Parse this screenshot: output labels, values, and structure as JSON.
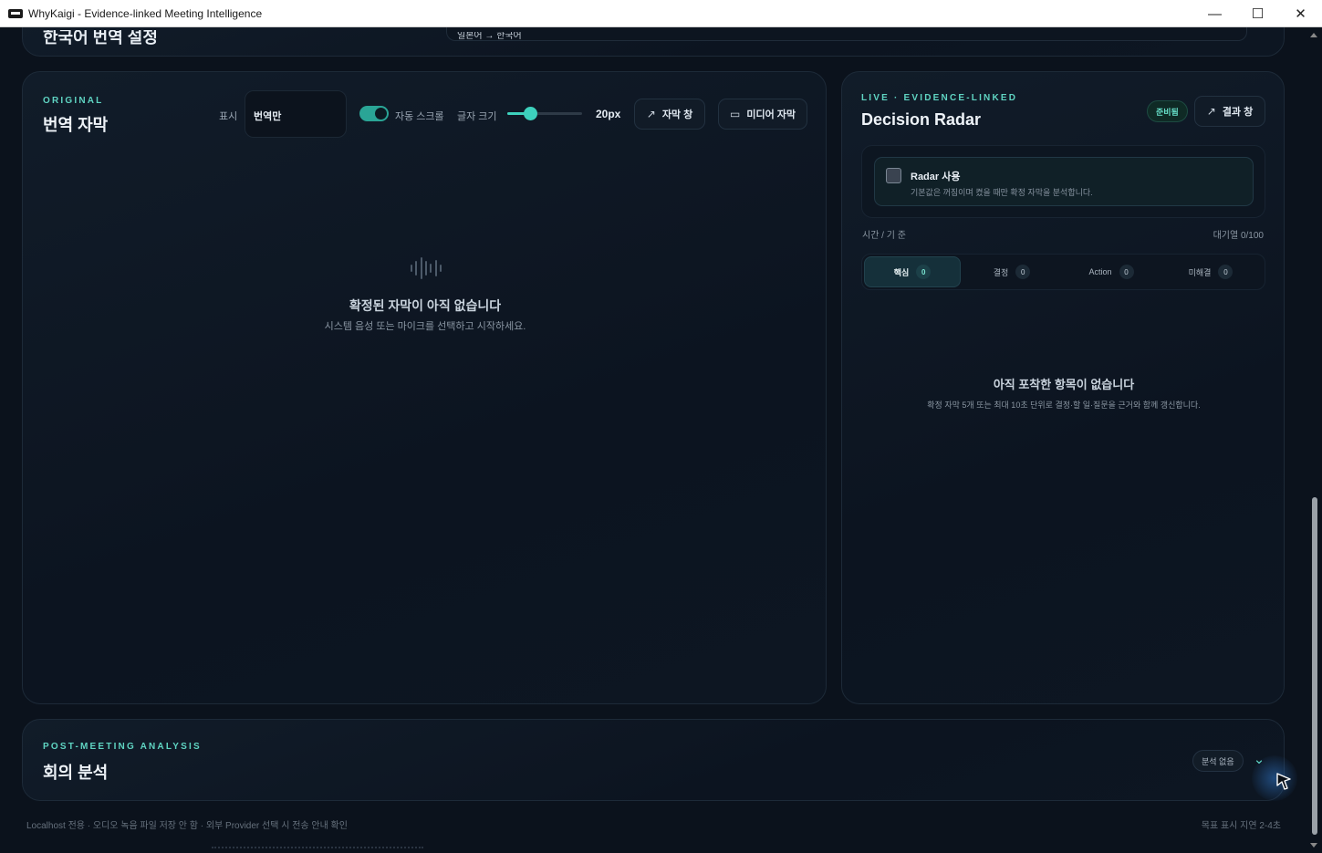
{
  "window": {
    "title": "WhyKaigi - Evidence-linked Meeting Intelligence",
    "minimize": "—",
    "maximize": "☐",
    "close": "✕"
  },
  "top_strip": {
    "title": "한국어 번역 설정",
    "language_pair": "일본어 → 한국어"
  },
  "subtitles": {
    "eyebrow": "ORIGINAL",
    "title": "번역 자막",
    "display_label": "표시",
    "display_value": "번역만",
    "autoscroll_label": "자동 스크롤",
    "autoscroll_on": true,
    "font_size_label": "글자 크기",
    "font_size_value": "20px",
    "font_size_level": 0.3,
    "subtitle_window_button": "자막 창",
    "media_subtitle_button": "미디어 자막",
    "empty_title": "확정된 자막이 아직 없습니다",
    "empty_sub": "시스템 음성 또는 마이크를 선택하고 시작하세요."
  },
  "radar": {
    "eyebrow": "LIVE · EVIDENCE-LINKED",
    "title": "Decision Radar",
    "status_badge": "준비됨",
    "results_window_button": "결과 창",
    "use_label": "Radar 사용",
    "use_desc": "기본값은 꺼짐이며 켰을 때만 확정 자막을 분석합니다.",
    "use_checked": false,
    "meta_left": "시간 / 기 준",
    "meta_right": "대기열 0/100",
    "tabs": [
      {
        "label": "핵심",
        "count": "0"
      },
      {
        "label": "결정",
        "count": "0"
      },
      {
        "label": "Action",
        "count": "0"
      },
      {
        "label": "미해결",
        "count": "0"
      }
    ],
    "empty_title": "아직 포착한 항목이 없습니다",
    "empty_sub": "확정 자막 5개 또는 최대 10초 단위로 결정·할 일·질문을 근거와 함께 갱신합니다."
  },
  "analysis": {
    "eyebrow": "POST-MEETING ANALYSIS",
    "title": "회의 분석",
    "status_badge": "분석 없음"
  },
  "footer": {
    "left": "Localhost 전용 · 오디오 녹음 파일 저장 안 함 · 외부 Provider 선택 시 전송 안내 확인",
    "right": "목표 표시 지연 2-4초"
  },
  "colors": {
    "accent": "#3dd1bd",
    "background": "#0b121c",
    "card": "#0f1824"
  }
}
